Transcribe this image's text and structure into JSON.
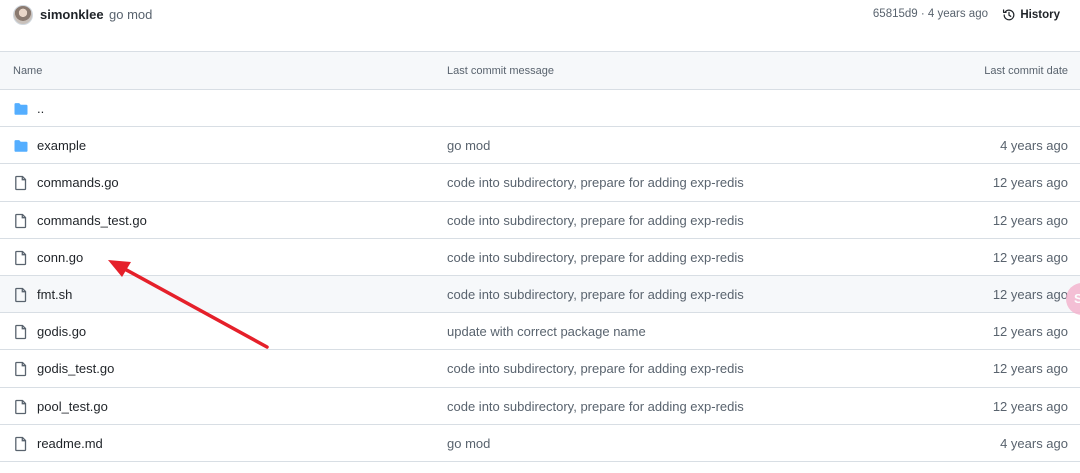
{
  "commit_bar": {
    "author": "simonklee",
    "message": "go mod",
    "meta": "65815d9 · 4 years ago",
    "history_label": "History"
  },
  "table": {
    "headers": {
      "name": "Name",
      "message": "Last commit message",
      "date": "Last commit date"
    },
    "rows": [
      {
        "type": "folder",
        "name": "..",
        "message": "",
        "date": ""
      },
      {
        "type": "folder",
        "name": "example",
        "message": "go mod",
        "date": "4 years ago"
      },
      {
        "type": "file",
        "name": "commands.go",
        "message": "code into subdirectory, prepare for adding exp-redis",
        "date": "12 years ago"
      },
      {
        "type": "file",
        "name": "commands_test.go",
        "message": "code into subdirectory, prepare for adding exp-redis",
        "date": "12 years ago"
      },
      {
        "type": "file",
        "name": "conn.go",
        "message": "code into subdirectory, prepare for adding exp-redis",
        "date": "12 years ago"
      },
      {
        "type": "file",
        "name": "fmt.sh",
        "message": "code into subdirectory, prepare for adding exp-redis",
        "date": "12 years ago"
      },
      {
        "type": "file",
        "name": "godis.go",
        "message": "update with correct package name",
        "date": "12 years ago"
      },
      {
        "type": "file",
        "name": "godis_test.go",
        "message": "code into subdirectory, prepare for adding exp-redis",
        "date": "12 years ago"
      },
      {
        "type": "file",
        "name": "pool_test.go",
        "message": "code into subdirectory, prepare for adding exp-redis",
        "date": "12 years ago"
      },
      {
        "type": "file",
        "name": "readme.md",
        "message": "go mod",
        "date": "4 years ago"
      }
    ]
  },
  "colors": {
    "folder": "#54aeff",
    "file_icon": "#59636e",
    "annotation_arrow": "#e5202a",
    "bubble": "#f4b6cf"
  },
  "annotation": {
    "type": "arrow",
    "points_to": "conn.go"
  }
}
